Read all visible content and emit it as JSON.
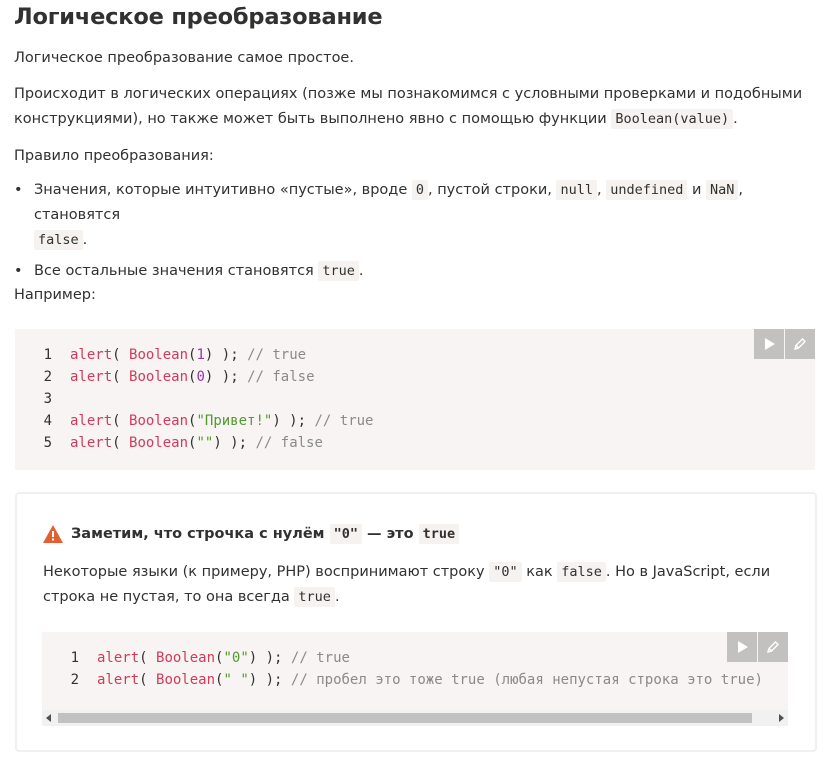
{
  "title": "Логическое преобразование",
  "intro": "Логическое преобразование самое простое.",
  "p2": {
    "line1": "Происходит в логических операциях (позже мы познакомимся с условными проверками и подобными",
    "line2": "конструкциями), но также может быть выполнено явно с помощью функции",
    "code": "Boolean(value)",
    "end": "."
  },
  "rule": "Правило преобразования:",
  "bullet_marker": "•",
  "bullets": {
    "b1": {
      "t1": "Значения, которые интуитивно «пустые», вроде",
      "c1": "0",
      "t2": ", пустой строки,",
      "c2": "null",
      "t3": ",",
      "c3": "undefined",
      "t4": "и",
      "c4": "NaN",
      "t5": ", становятся",
      "c5": "false",
      "t6": "."
    },
    "b2": {
      "t1": "Все остальные значения становятся",
      "c1": "true",
      "t2": "."
    }
  },
  "example_label": "Например:",
  "code1": {
    "line_numbers": [
      "1",
      "2",
      "3",
      "4",
      "5"
    ],
    "lines": [
      {
        "fn": "alert",
        "p1": "( ",
        "fn2": "Boolean",
        "p2": "(",
        "arg": "1",
        "p3": ") ); ",
        "cm": "// true"
      },
      {
        "fn": "alert",
        "p1": "( ",
        "fn2": "Boolean",
        "p2": "(",
        "arg": "0",
        "p3": ") ); ",
        "cm": "// false"
      },
      null,
      {
        "fn": "alert",
        "p1": "( ",
        "fn2": "Boolean",
        "p2": "(",
        "arg": "\"Привет!\"",
        "p3": ") ); ",
        "cm": "// true"
      },
      {
        "fn": "alert",
        "p1": "( ",
        "fn2": "Boolean",
        "p2": "(",
        "arg": "\"\"",
        "p3": ") ); ",
        "cm": "// false"
      }
    ]
  },
  "callout": {
    "head_text": "Заметим, что строчка с нулём",
    "head_code1": "\"0\"",
    "head_mid": "— это",
    "head_code2": "true",
    "body": {
      "t1": "Некоторые языки (к примеру, PHP) воспринимают строку",
      "c1": "\"0\"",
      "t2": "как",
      "c2": "false",
      "t3": ". Но в JavaScript, если",
      "t4": "строка не пустая, то она всегда",
      "c3": "true",
      "t5": "."
    },
    "code": {
      "line_numbers": [
        "1",
        "2"
      ],
      "lines": [
        {
          "fn": "alert",
          "p1": "( ",
          "fn2": "Boolean",
          "p2": "(",
          "arg": "\"0\"",
          "p3": ") ); ",
          "cm": "// true"
        },
        {
          "fn": "alert",
          "p1": "( ",
          "fn2": "Boolean",
          "p2": "(",
          "arg": "\" \"",
          "p3": ") ); ",
          "cm": "// пробел это тоже true (любая непустая строка это true)"
        }
      ]
    }
  },
  "colors": {
    "function": "#d03b5b",
    "string": "#529b2f",
    "number": "#9a32a8",
    "comment": "#8a8a8a",
    "code_bg": "#f7f4f3",
    "warning": "#e05f33"
  },
  "icons": {
    "run": "play-icon",
    "edit": "pencil-icon",
    "warning": "warning-triangle-icon"
  }
}
